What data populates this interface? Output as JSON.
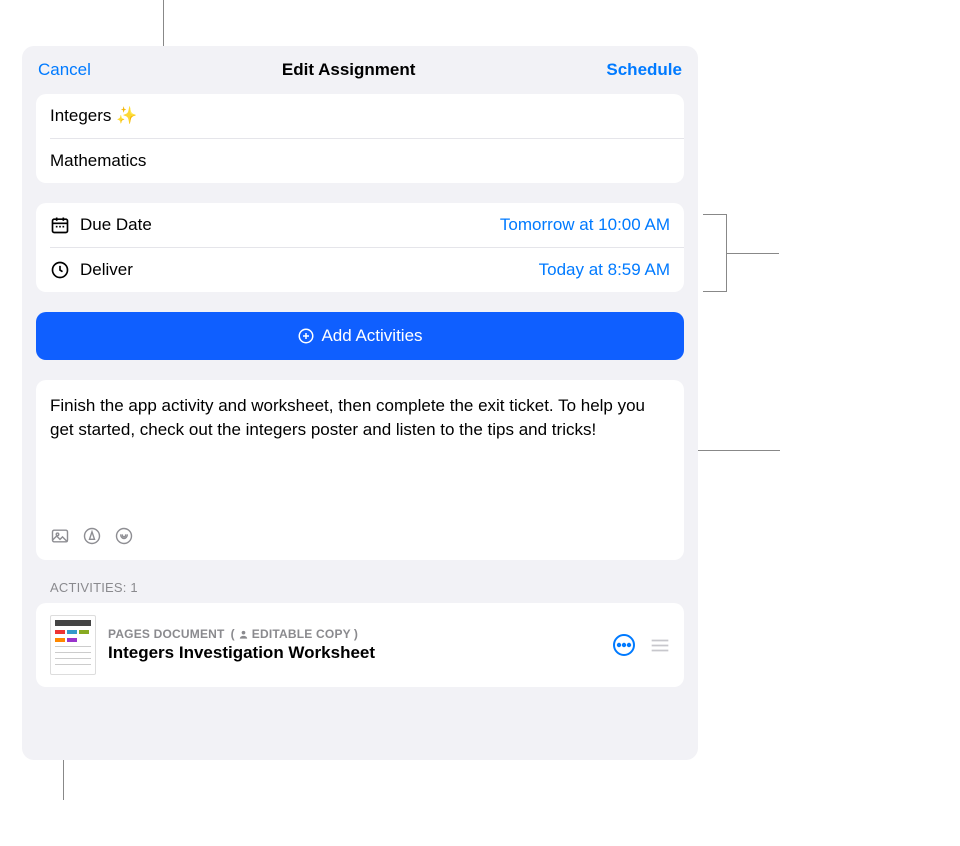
{
  "header": {
    "cancel": "Cancel",
    "title": "Edit Assignment",
    "schedule": "Schedule"
  },
  "assignment": {
    "name": "Integers ✨",
    "class": "Mathematics"
  },
  "schedule": {
    "due_label": "Due Date",
    "due_value": "Tomorrow at 10:00 AM",
    "deliver_label": "Deliver",
    "deliver_value": "Today at 8:59 AM"
  },
  "add_activities": "Add Activities",
  "instructions": "Finish the app activity and worksheet, then complete the exit ticket. To help you get started, check out the integers poster and listen to the tips and tricks!",
  "activities_header": "ACTIVITIES: 1",
  "activities": [
    {
      "type": "PAGES DOCUMENT",
      "badge": "EDITABLE COPY",
      "title": "Integers Investigation Worksheet"
    }
  ]
}
